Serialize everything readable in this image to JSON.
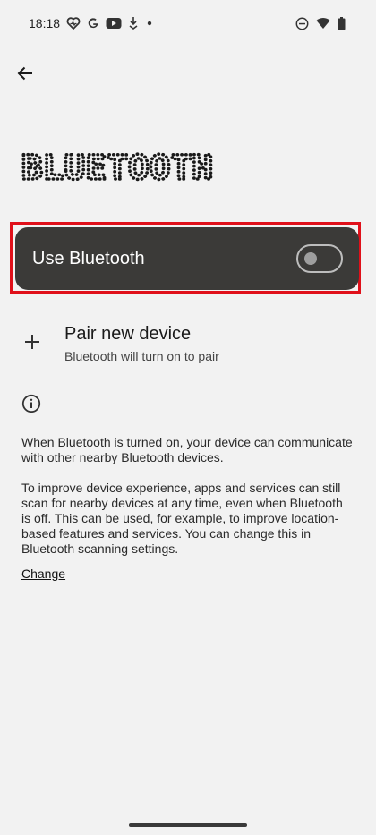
{
  "status_bar": {
    "time": "18:18",
    "left_icons": [
      "heart-pulse-icon",
      "google-icon",
      "youtube-icon",
      "download-icon",
      "dot-icon"
    ],
    "right_icons": [
      "do-not-disturb-icon",
      "wifi-icon",
      "battery-icon"
    ]
  },
  "header": {
    "back_icon": "arrow-back-icon",
    "title": "BLUETOOTH"
  },
  "toggle": {
    "label": "Use Bluetooth",
    "state": "off",
    "highlight_color": "#e0101a",
    "card_color": "#3b3a38"
  },
  "pair": {
    "icon": "plus-icon",
    "title": "Pair new device",
    "subtitle": "Bluetooth will turn on to pair"
  },
  "info": {
    "icon": "info-icon",
    "paragraph1": "When Bluetooth is turned on, your device can communicate with other nearby Bluetooth devices.",
    "paragraph2": "To improve device experience, apps and services can still scan for nearby devices at any time, even when Bluetooth is off. This can be used, for example, to improve location-based features and services. You can change this in Bluetooth scanning settings.",
    "link": "Change"
  }
}
